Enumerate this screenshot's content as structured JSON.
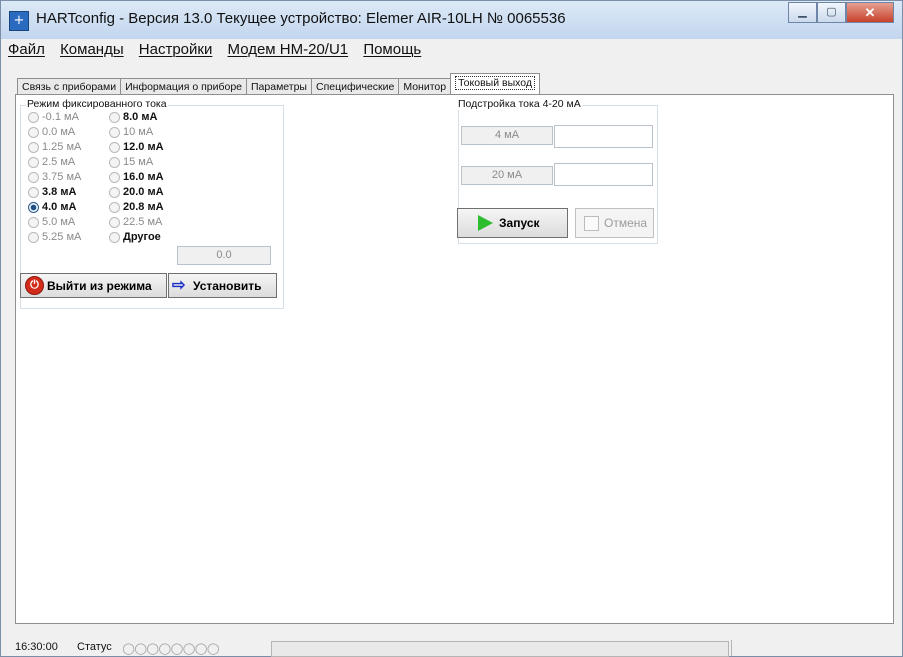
{
  "window": {
    "title": "HARTconfig - Версия 13.0 Текущее устройство: Elemer AIR-10LH № 0065536",
    "app_icon_glyph": "+"
  },
  "menu": [
    "Файл",
    "Команды",
    "Настройки",
    "Модем HM-20/U1",
    "Помощь"
  ],
  "tabs": [
    {
      "label": "Связь с приборами",
      "active": false
    },
    {
      "label": "Информация о приборе",
      "active": false
    },
    {
      "label": "Параметры",
      "active": false
    },
    {
      "label": "Специфические",
      "active": false
    },
    {
      "label": "Монитор",
      "active": false
    },
    {
      "label": "Токовый выход",
      "active": true
    }
  ],
  "fixed_current": {
    "group_label": "Режим фиксированного тока",
    "options_col1": [
      {
        "label": "-0.1 мА",
        "enabled": false,
        "checked": false
      },
      {
        "label": "0.0 мА",
        "enabled": false,
        "checked": false
      },
      {
        "label": "1.25 мА",
        "enabled": false,
        "checked": false
      },
      {
        "label": "2.5 мА",
        "enabled": false,
        "checked": false
      },
      {
        "label": "3.75 мА",
        "enabled": false,
        "checked": false
      },
      {
        "label": "3.8 мА",
        "enabled": true,
        "checked": false
      },
      {
        "label": "4.0 мА",
        "enabled": true,
        "checked": true
      },
      {
        "label": "5.0 мА",
        "enabled": false,
        "checked": false
      },
      {
        "label": "5.25 мА",
        "enabled": false,
        "checked": false
      }
    ],
    "options_col2": [
      {
        "label": "8.0 мА",
        "enabled": true,
        "checked": false
      },
      {
        "label": "10 мА",
        "enabled": false,
        "checked": false
      },
      {
        "label": "12.0 мА",
        "enabled": true,
        "checked": false
      },
      {
        "label": "15 мА",
        "enabled": false,
        "checked": false
      },
      {
        "label": "16.0 мА",
        "enabled": true,
        "checked": false
      },
      {
        "label": "20.0 мА",
        "enabled": true,
        "checked": false
      },
      {
        "label": "20.8 мА",
        "enabled": true,
        "checked": false
      },
      {
        "label": "22.5 мА",
        "enabled": false,
        "checked": false
      },
      {
        "label": "Другое",
        "enabled": true,
        "checked": false
      }
    ],
    "other_value": "0.0",
    "exit_button": "Выйти из режима",
    "set_button": "Установить"
  },
  "trim": {
    "group_label": "Подстройка тока 4-20 мА",
    "label_4ma": "4 мА",
    "value_4ma": "",
    "label_20ma": "20 мА",
    "value_20ma": "",
    "start_button": "Запуск",
    "cancel_button": "Отмена"
  },
  "status": {
    "time": "16:30:00",
    "label": "Статус",
    "circles": "○○○○○○○○",
    "progress": 0
  }
}
